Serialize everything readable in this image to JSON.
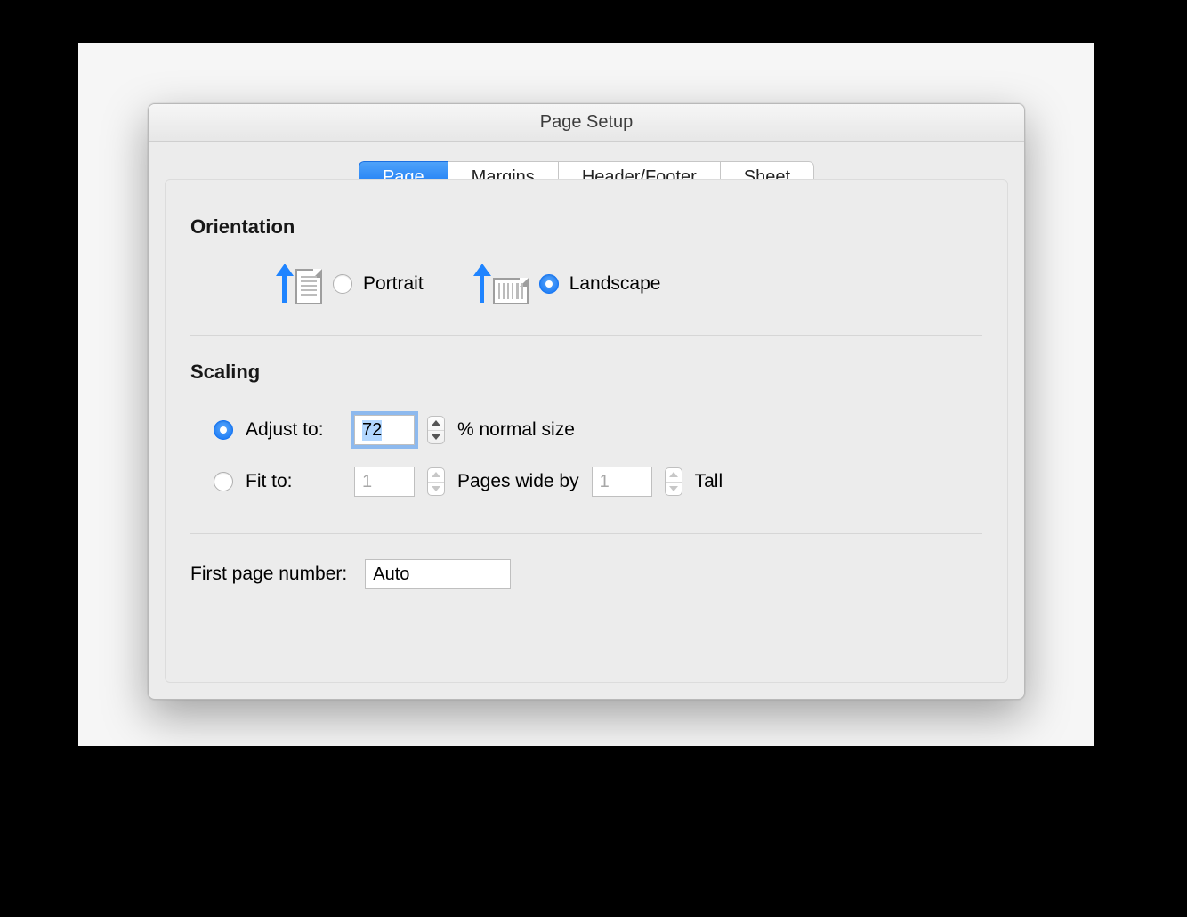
{
  "window": {
    "title": "Page Setup"
  },
  "tabs": {
    "items": [
      "Page",
      "Margins",
      "Header/Footer",
      "Sheet"
    ],
    "active_index": 0
  },
  "orientation": {
    "heading": "Orientation",
    "options": {
      "portrait": "Portrait",
      "landscape": "Landscape"
    },
    "selected": "landscape"
  },
  "scaling": {
    "heading": "Scaling",
    "adjust": {
      "label": "Adjust to:",
      "value": "72",
      "suffix": "% normal size",
      "selected": true
    },
    "fit": {
      "label": "Fit to:",
      "wide": "1",
      "mid_text": "Pages wide by",
      "tall": "1",
      "tall_label": "Tall",
      "selected": false
    }
  },
  "first_page": {
    "label": "First page number:",
    "value": "Auto"
  }
}
